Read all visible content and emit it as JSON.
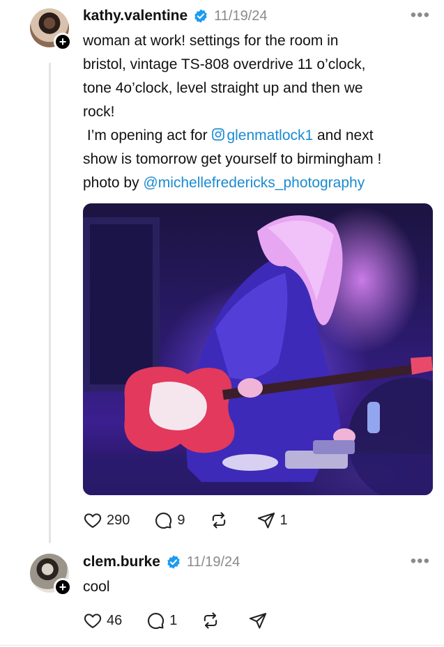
{
  "post1": {
    "username": "kathy.valentine",
    "date": "11/19/24",
    "more": "•••",
    "follow_badge": "+",
    "text_lines": [
      "woman at work! settings for the room in",
      "bristol, vintage TS-808 overdrive 11 o’clock,",
      "tone 4o’clock, level straight up and then we",
      "rock!"
    ],
    "line5_prefix": " I’m opening act for ",
    "line5_mention": "glenmatlock1",
    "line5_suffix": " and next",
    "line6": "show is tomorrow get yourself to birmingham !",
    "line7_prefix": "photo by ",
    "line7_mention": "@michellefredericks_photography",
    "likes": "290",
    "comments": "9",
    "shares": "1"
  },
  "post2": {
    "username": "clem.burke",
    "date": "11/19/24",
    "more": "•••",
    "follow_badge": "+",
    "text": "cool",
    "likes": "46",
    "comments": "1"
  },
  "colors": {
    "mention": "#1a8ad1",
    "verified": "#1d9bf0",
    "muted": "#8a8a8a"
  },
  "icons": [
    "heart-icon",
    "comment-icon",
    "repost-icon",
    "share-icon",
    "verified-icon",
    "instagram-icon",
    "more-icon"
  ]
}
